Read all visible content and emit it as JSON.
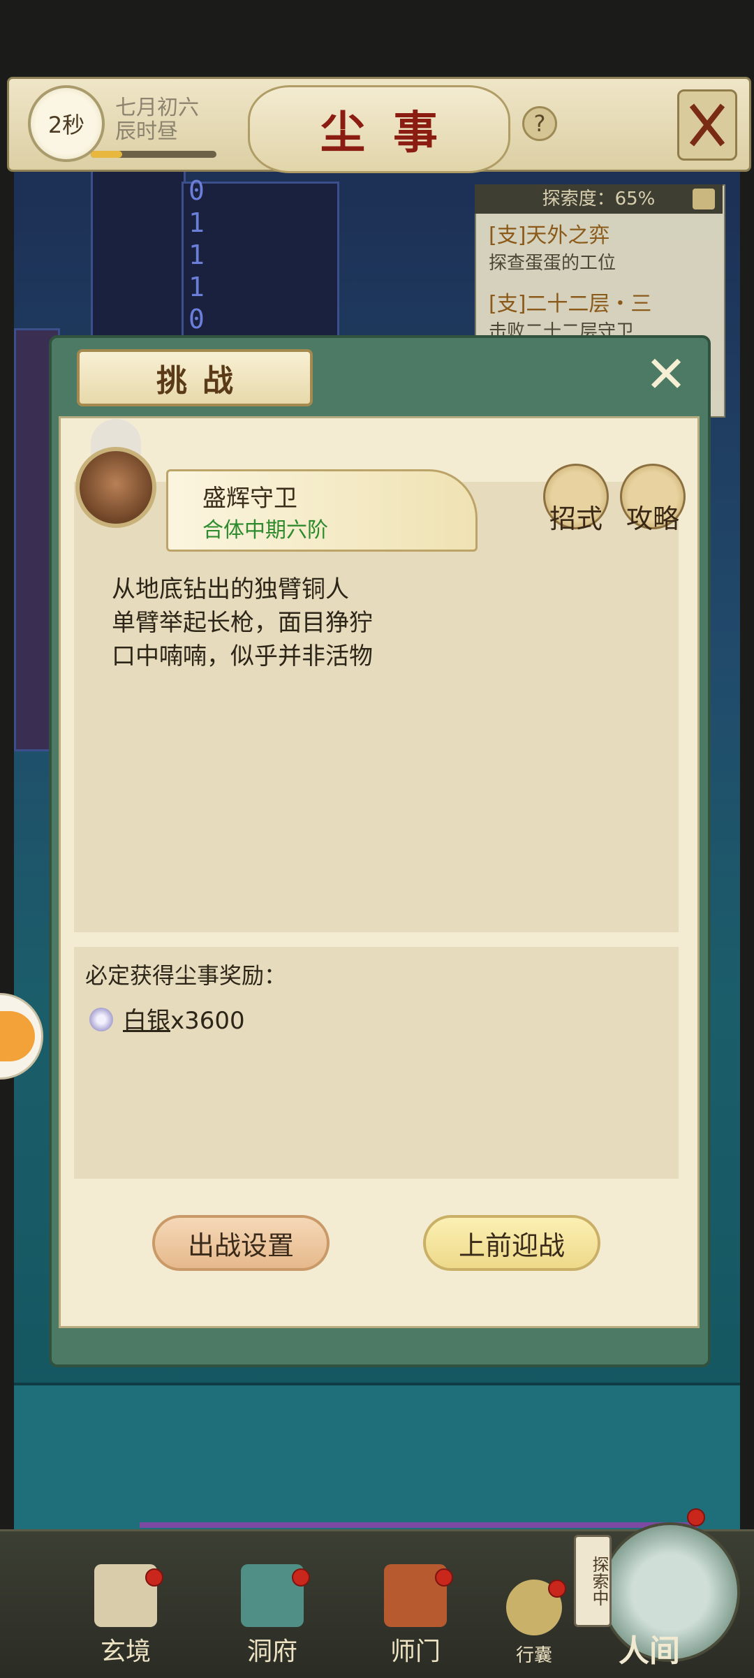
{
  "header": {
    "timer": "2秒",
    "date_line1": "七月初六",
    "date_line2": "辰时昼",
    "title": "尘事",
    "progress": 0.25
  },
  "explore": {
    "label": "探索度：65%",
    "value": 0.65,
    "quests": [
      {
        "title": "[支]天外之弈",
        "desc": "探查蛋蛋的工位"
      },
      {
        "title": "[支]二十二层・三",
        "desc": "击败二十二层守卫"
      }
    ]
  },
  "scene": {
    "binary_digits": [
      "0",
      "1",
      "1",
      "1",
      "0"
    ]
  },
  "dialog": {
    "tab_title": "挑战",
    "enemy_name": "盛辉守卫",
    "enemy_rank": "合体中期六阶",
    "skills_label": "招式",
    "guide_label": "攻略",
    "description": [
      "从地底钻出的独臂铜人",
      "单臂举起长枪，面目狰狞",
      "口中喃喃，似乎并非活物"
    ],
    "reward_title": "必定获得尘事奖励：",
    "reward_name": "白银",
    "reward_qty": "x3600",
    "settings_button": "出战设置",
    "fight_button": "上前迎战"
  },
  "nav": {
    "items": [
      "玄境",
      "洞府",
      "师门",
      "行囊"
    ],
    "explore_tag": "探索中",
    "world": "人间"
  },
  "colors": {
    "title_red": "#8a1c12",
    "rank_green": "#2d8b2e",
    "badge_red": "#c9261c"
  }
}
